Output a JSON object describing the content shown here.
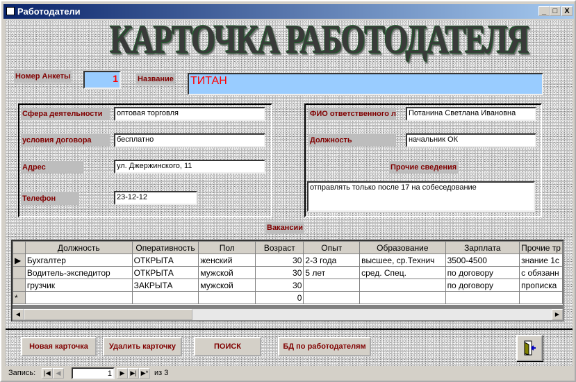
{
  "window": {
    "title": "Работодатели",
    "minimize": "_",
    "maximize": "□",
    "close": "X"
  },
  "header": {
    "wordart": "КАРТОЧКА РАБОТОДАТЕЛЯ"
  },
  "top": {
    "number_label": "Номер Анкеты",
    "number_value": "1",
    "name_label": "Название",
    "name_value": "ТИТАН"
  },
  "left": {
    "sphere_label": "Сфера деятельности",
    "sphere_value": "оптовая торговля",
    "terms_label": "условия договора",
    "terms_value": "бесплатно",
    "address_label": "Адрес",
    "address_value": "ул. Джержинского, 11",
    "phone_label": "Телефон",
    "phone_value": "23-12-12"
  },
  "right": {
    "fio_label": "ФИО ответственного л",
    "fio_value": "Потанина Светлана Ивановна",
    "position_label": "Должность",
    "position_value": "начальник ОК",
    "other_label": "Прочие сведения",
    "other_value": "отправлять только после 17 на собеседование"
  },
  "vacancies": {
    "label": "Вакансии",
    "columns": [
      "Должность",
      "Оперативность",
      "Пол",
      "Возраст",
      "Опыт",
      "Образование",
      "Зарплата",
      "Прочие тр"
    ],
    "rows": [
      [
        "Бухгалтер",
        "ОТКРЫТА",
        "женский",
        "30",
        "2-3 года",
        "высшее, ср.Технич",
        "3500-4500",
        "знание 1с"
      ],
      [
        "Водитель-экспедитор",
        "ОТКРЫТА",
        "мужской",
        "30",
        "5 лет",
        "сред. Спец.",
        "по договору",
        "с обязанн"
      ],
      [
        "грузчик",
        "ЗАКРЫТА",
        "мужской",
        "30",
        "",
        "",
        "по договору",
        "прописка"
      ],
      [
        "",
        "",
        "",
        "0",
        "",
        "",
        "",
        ""
      ]
    ],
    "current_marker": "▶",
    "new_marker": "*"
  },
  "buttons": {
    "new": "Новая карточка",
    "delete": "Удалить карточку",
    "search": "ПОИСК",
    "db": "БД по работодателям"
  },
  "nav": {
    "label": "Запись:",
    "current": "1",
    "of": "из 3"
  }
}
